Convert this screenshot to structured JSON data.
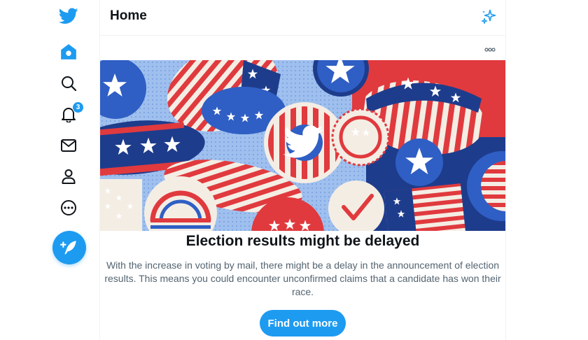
{
  "sidebar": {
    "logo_icon": "twitter-bird-icon",
    "items": [
      {
        "icon": "home-icon"
      },
      {
        "icon": "search-icon"
      },
      {
        "icon": "bell-icon",
        "badge": "3"
      },
      {
        "icon": "mail-icon"
      },
      {
        "icon": "person-icon"
      },
      {
        "icon": "more-circle-icon"
      }
    ],
    "compose_icon": "feather-plus-icon"
  },
  "header": {
    "title": "Home",
    "sparkle_icon": "sparkle-icon"
  },
  "notice": {
    "more_icon": "ellipsis-icon",
    "title": "Election results might be delayed",
    "body": "With the increase in voting by mail, there might be a delay in the announcement of election results. This means you could encounter unconfirmed claims that a candidate has won their race.",
    "cta_label": "Find out more"
  },
  "colors": {
    "accent": "#1d9bf0",
    "flag_red": "#e03a3e",
    "flag_navy": "#1e3c8c",
    "flag_blue": "#2f5fc4"
  }
}
